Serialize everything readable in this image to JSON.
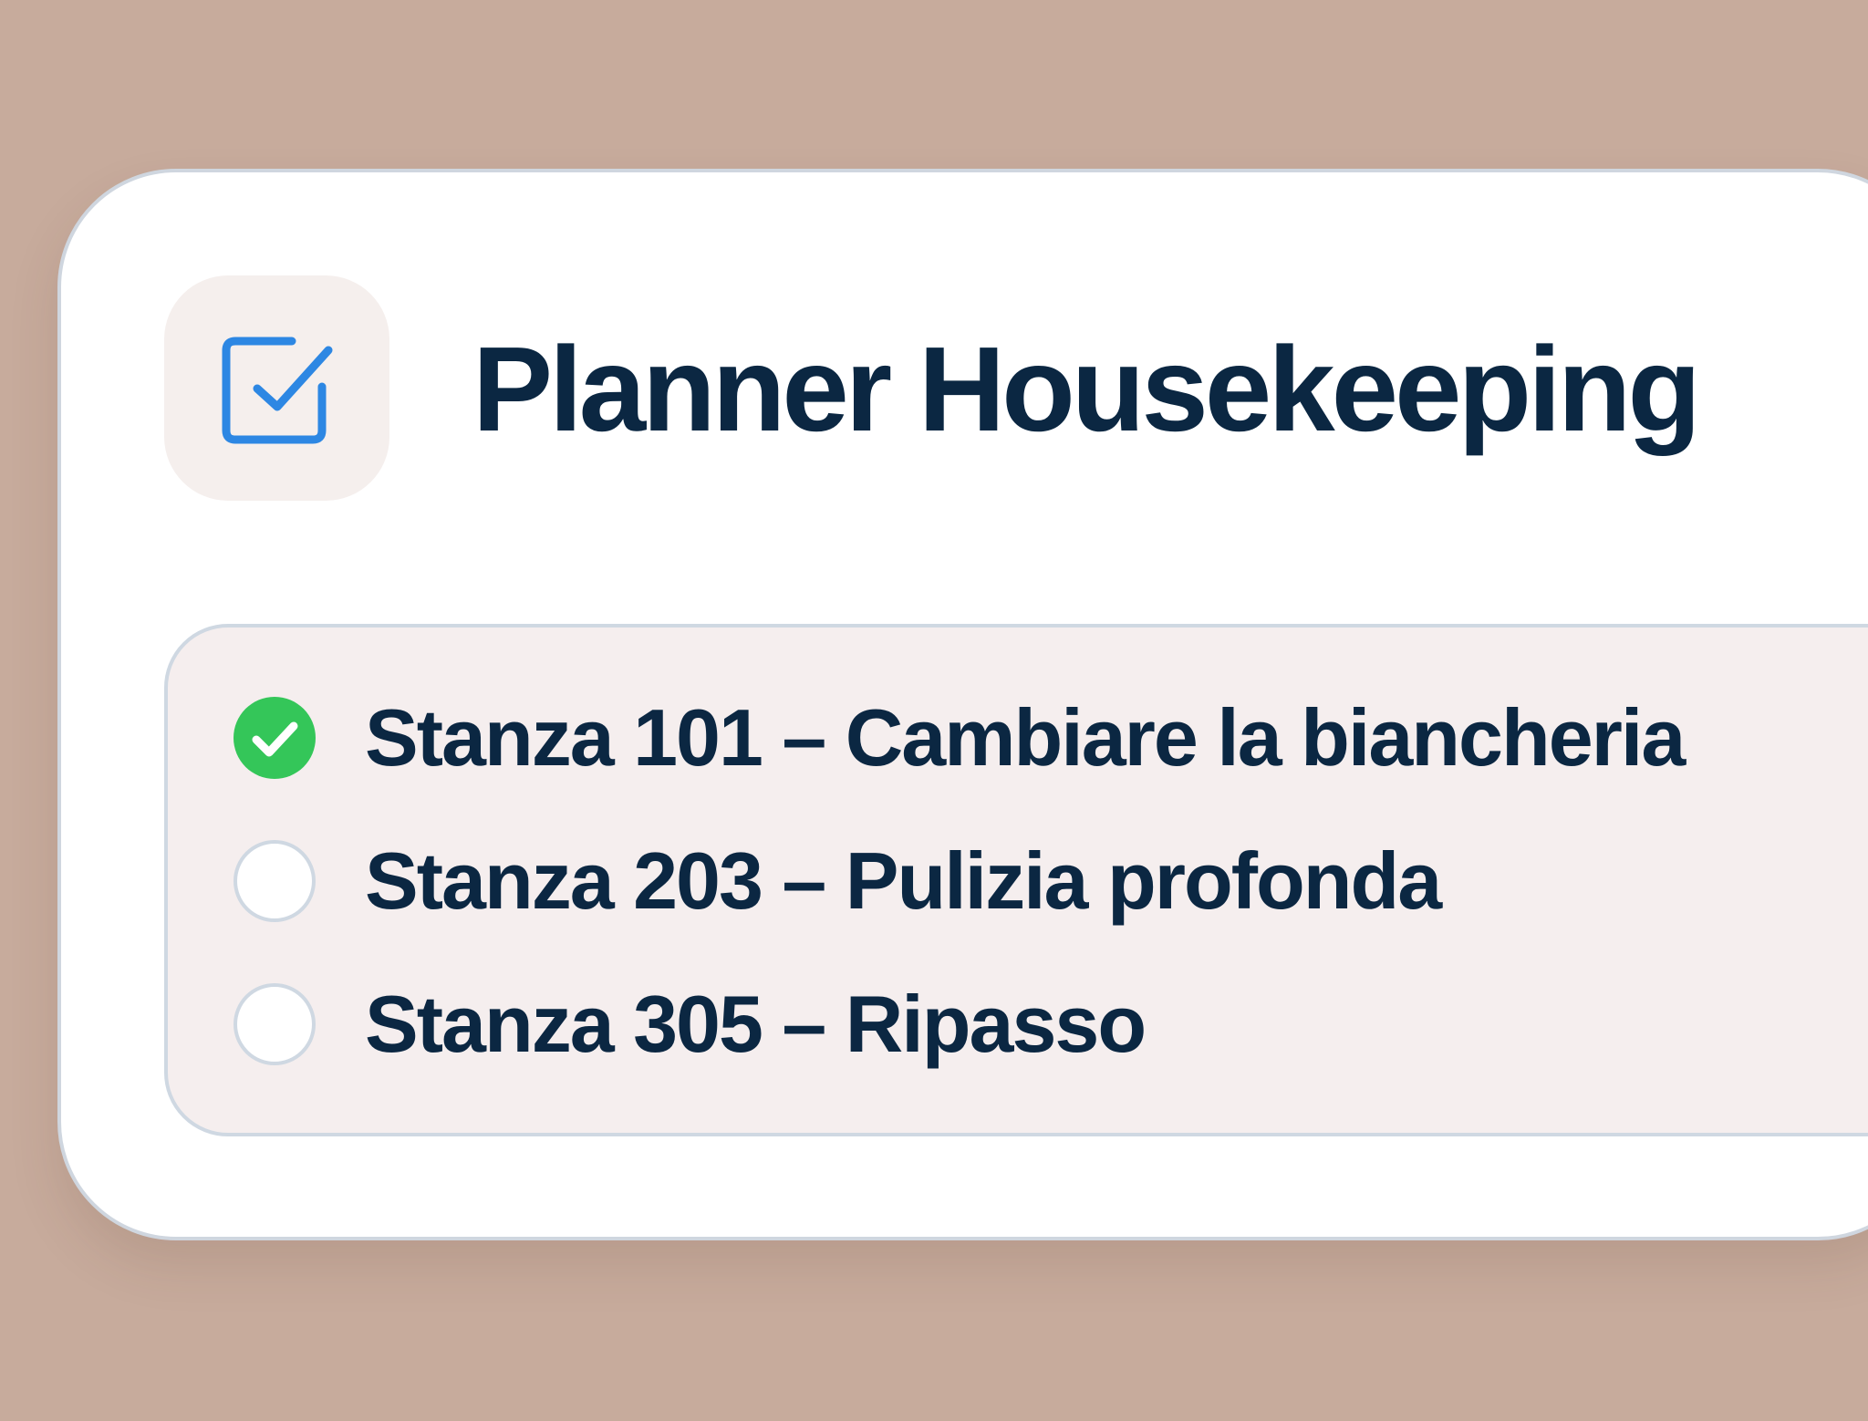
{
  "header": {
    "app_icon": "checkbox-icon",
    "title": "Planner Housekeeping"
  },
  "tasks": [
    {
      "label": "Stanza 101 – Cambiare la biancheria",
      "status": "completed",
      "status_icon": "checkmark-circle-icon"
    },
    {
      "label": "Stanza 203 – Pulizia profonda",
      "status": "pending",
      "status_icon": "empty-circle-icon"
    },
    {
      "label": "Stanza 305 – Ripasso",
      "status": "pending",
      "status_icon": "empty-circle-icon"
    }
  ],
  "colors": {
    "background": "#c7ab9c",
    "card": "#ffffff",
    "panel": "#f5eeee",
    "text": "#0b2742",
    "accent_blue": "#2d87e3",
    "success_green": "#34c659",
    "border": "#cfd8e2"
  }
}
